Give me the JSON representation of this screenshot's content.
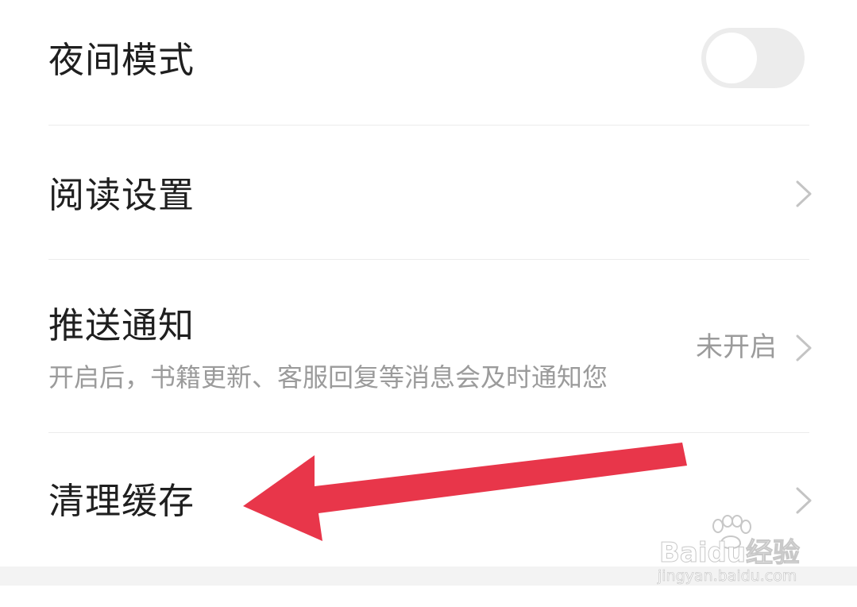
{
  "settings": {
    "items": [
      {
        "id": "night-mode",
        "title": "夜间模式",
        "control": "toggle",
        "enabled": false
      },
      {
        "id": "reading-settings",
        "title": "阅读设置",
        "control": "chevron"
      },
      {
        "id": "push-notifications",
        "title": "推送通知",
        "subtitle": "开启后，书籍更新、客服回复等消息会及时通知您",
        "status": "未开启",
        "control": "chevron"
      },
      {
        "id": "clear-cache",
        "title": "清理缓存",
        "control": "chevron"
      }
    ]
  },
  "annotation": {
    "type": "arrow",
    "color": "#e8364a",
    "points_to": "clear-cache"
  },
  "watermark": {
    "brand": "Baidu经验",
    "url": "jingyan.baidu.com"
  },
  "colors": {
    "text_primary": "#1f1f1f",
    "text_secondary": "#9b9b9b",
    "divider": "#ececec",
    "toggle_off": "#ececec",
    "arrow": "#e8364a"
  }
}
